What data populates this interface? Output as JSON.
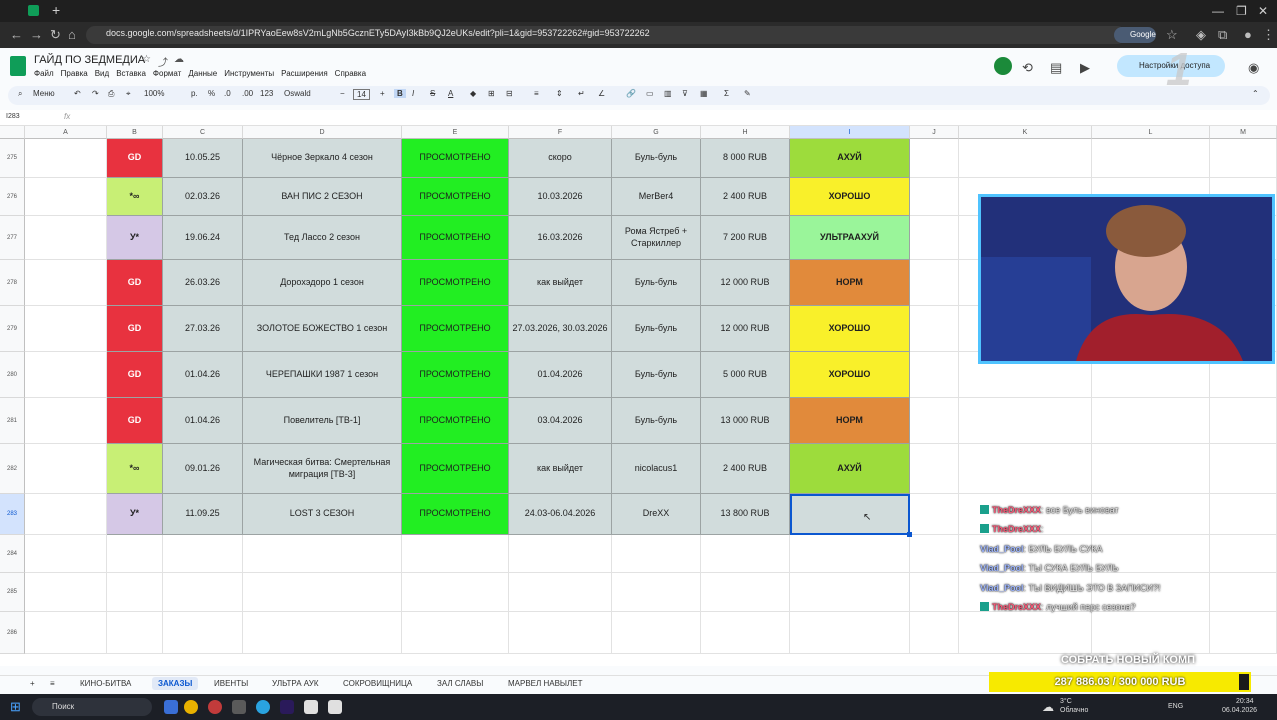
{
  "browser": {
    "url": "docs.google.com/spreadsheets/d/1IPRYaoEew8sV2mLgNb5GcznETy5DAyI3kBb9QJ2eUKs/edit?pli=1&gid=953722262#gid=953722262",
    "google_badge": "Google"
  },
  "app": {
    "title": "ГАЙД ПО ЗЕДМЕДИА",
    "menu": [
      "Файл",
      "Правка",
      "Вид",
      "Вставка",
      "Формат",
      "Данные",
      "Инструменты",
      "Расширения",
      "Справка"
    ],
    "share_label": "Настройки доступа"
  },
  "toolbar": {
    "menus_label": "Меню",
    "zoom": "100%",
    "currency": "р.",
    "percent": "%",
    "dec_dec": ".0",
    "dec_inc": ".00",
    "num_fmt": "123",
    "font": "Oswald",
    "font_size": "14",
    "bold": "B",
    "italic": "I",
    "strike": "S",
    "text_color": "A"
  },
  "formula_bar": {
    "cell_ref": "I283",
    "fx": "fx"
  },
  "columns": [
    "A",
    "B",
    "C",
    "D",
    "E",
    "F",
    "G",
    "H",
    "I",
    "J",
    "K",
    "L",
    "M"
  ],
  "rows": [
    {
      "num": "275",
      "b": "GD",
      "c": "10.05.25",
      "d": "Чёрное Зеркало 4 сезон",
      "e": "ПРОСМОТРЕНО",
      "f": "скоро",
      "g": "Буль-буль",
      "h": "8 000 RUB",
      "i": "АХУЙ"
    },
    {
      "num": "276",
      "b": "*∞",
      "c": "02.03.26",
      "d": "ВАН ПИС 2 СЕЗОН",
      "e": "ПРОСМОТРЕНО",
      "f": "10.03.2026",
      "g": "MerBer4",
      "h": "2 400 RUB",
      "i": "ХОРОШО"
    },
    {
      "num": "277",
      "b": "У*",
      "c": "19.06.24",
      "d": "Тед Лассо 2 сезон",
      "e": "ПРОСМОТРЕНО",
      "f": "16.03.2026",
      "g": "Рома Ястреб + Старкиллер",
      "h": "7 200 RUB",
      "i": "УЛЬТРААХУЙ"
    },
    {
      "num": "278",
      "b": "GD",
      "c": "26.03.26",
      "d": "Дорохэдоро 1 сезон",
      "e": "ПРОСМОТРЕНО",
      "f": "как выйдет",
      "g": "Буль-буль",
      "h": "12 000 RUB",
      "i": "НОРМ"
    },
    {
      "num": "279",
      "b": "GD",
      "c": "27.03.26",
      "d": "ЗОЛОТОЕ БОЖЕСТВО 1 сезон",
      "e": "ПРОСМОТРЕНО",
      "f": "27.03.2026, 30.03.2026",
      "g": "Буль-буль",
      "h": "12 000 RUB",
      "i": "ХОРОШО"
    },
    {
      "num": "280",
      "b": "GD",
      "c": "01.04.26",
      "d": "ЧЕРЕПАШКИ 1987 1 сезон",
      "e": "ПРОСМОТРЕНО",
      "f": "01.04.2026",
      "g": "Буль-буль",
      "h": "5 000 RUB",
      "i": "ХОРОШО"
    },
    {
      "num": "281",
      "b": "GD",
      "c": "01.04.26",
      "d": "Повелитель [ТВ-1]",
      "e": "ПРОСМОТРЕНО",
      "f": "03.04.2026",
      "g": "Буль-буль",
      "h": "13 000 RUB",
      "i": "НОРМ"
    },
    {
      "num": "282",
      "b": "*∞",
      "c": "09.01.26",
      "d": "Магическая битва: Смертельная миграция [ТВ-3]",
      "e": "ПРОСМОТРЕНО",
      "f": "как выйдет",
      "g": "nicolacus1",
      "h": "2 400 RUB",
      "i": "АХУЙ"
    },
    {
      "num": "283",
      "b": "У*",
      "c": "11.09.25",
      "d": "LOST 3 СЕЗОН",
      "e": "ПРОСМОТРЕНО",
      "f": "24.03-06.04.2026",
      "g": "DreXX",
      "h": "13 800 RUB",
      "i": ""
    }
  ],
  "empty_rows": [
    "284",
    "285",
    "286"
  ],
  "colors": {
    "b_gd": "#e8323f",
    "b_inf": "#c8ef75",
    "b_u": "#d5c8e6",
    "cell_bg": "#d1dcdc",
    "viewed": "#22ee22",
    "rating_ahui": "#9ddc3c",
    "rating_good": "#f9f02a",
    "rating_ultra": "#9af59a",
    "rating_norm": "#e18a3b",
    "accent": "#0b57d0"
  },
  "sheet_tabs": [
    "КИНО-БИТВА",
    "ЗАКАЗЫ",
    "ИВЕНТЫ",
    "УЛЬТРА АУК",
    "СОКРОВИЩНИЦА",
    "ЗАЛ СЛАВЫ",
    "МАРВЕЛ НАВЫЛЕТ"
  ],
  "active_tab": "ЗАКАЗЫ",
  "chat": [
    {
      "user": "TheDreXXX",
      "text": ": все Буль виноват",
      "badge": true
    },
    {
      "user": "TheDreXXX",
      "text": ":",
      "badge": true
    },
    {
      "user": "Vlad_Pool",
      "text": ": БУЛЬ БУЛЬ СУКА",
      "badge": false
    },
    {
      "user": "Vlad_Pool",
      "text": ": ТЫ СУКА БУЛЬ БУЛЬ",
      "badge": false
    },
    {
      "user": "Vlad_Pool",
      "text": ": ТЫ ВИДИШЬ ЭТО В ЗАПИСИ?!",
      "badge": false
    },
    {
      "user": "TheDreXXX",
      "text": ": лучший перс сезона?",
      "badge": true
    }
  ],
  "donation": {
    "title": "СОБРАТЬ НОВЫЙ КОМП",
    "amount": "287 886.03 / 300 000 RUB",
    "progress": 0.9596
  },
  "taskbar": {
    "search": "Поиск",
    "weather_temp": "3°C",
    "weather_desc": "Облачно",
    "lang": "ENG",
    "time": "20:34",
    "date": "06.04.2026"
  }
}
